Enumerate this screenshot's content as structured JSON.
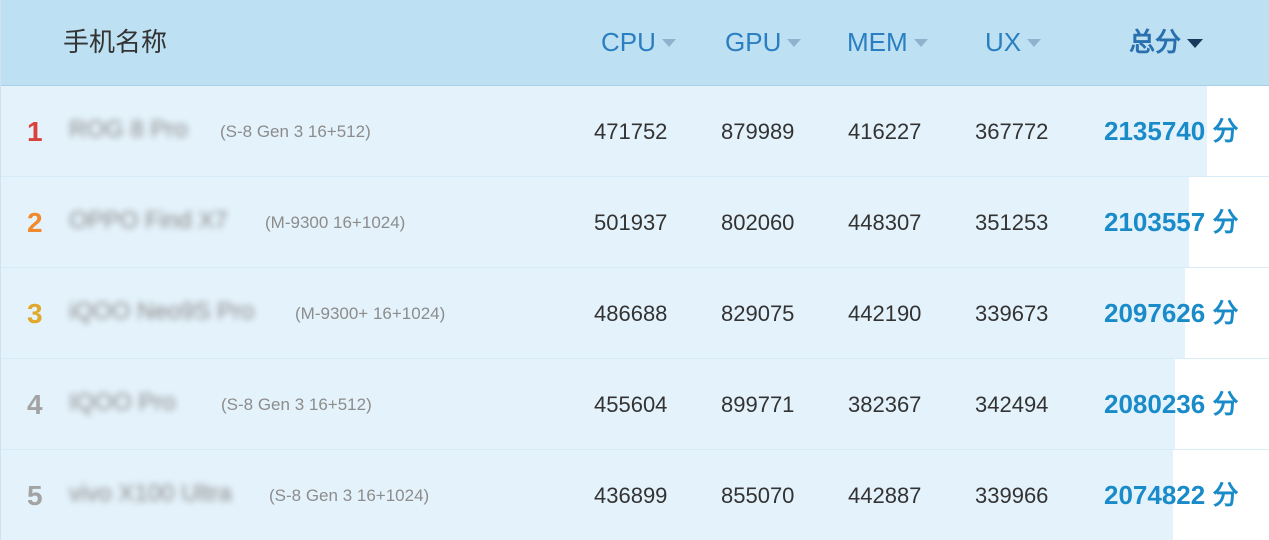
{
  "header": {
    "name_label": "手机名称",
    "cpu_label": "CPU",
    "gpu_label": "GPU",
    "mem_label": "MEM",
    "ux_label": "UX",
    "total_label": "总分"
  },
  "unit": "分",
  "colors": {
    "header_bg": "#bde0f3",
    "row_bar": "#e4f2fb",
    "total_text": "#1a8bc9",
    "rank_1": "#d9423c",
    "rank_2": "#f08a2c",
    "rank_3": "#e0a92a",
    "rank_other": "#a3a3a3"
  },
  "rows": [
    {
      "rank": "1",
      "name": "ROG 8 Pro",
      "chip": "(S-8 Gen 3 16+512)",
      "cpu": "471752",
      "gpu": "879989",
      "mem": "416227",
      "ux": "367772",
      "total": "2135740",
      "fill": 0.951
    },
    {
      "rank": "2",
      "name": "OPPO Find X7",
      "chip": "(M-9300 16+1024)",
      "cpu": "501937",
      "gpu": "802060",
      "mem": "448307",
      "ux": "351253",
      "total": "2103557",
      "fill": 0.937
    },
    {
      "rank": "3",
      "name": "iQOO Neo9S Pro",
      "chip": "(M-9300+ 16+1024)",
      "cpu": "486688",
      "gpu": "829075",
      "mem": "442190",
      "ux": "339673",
      "total": "2097626",
      "fill": 0.934
    },
    {
      "rank": "4",
      "name": "IQOO Pro",
      "chip": "(S-8 Gen 3 16+512)",
      "cpu": "455604",
      "gpu": "899771",
      "mem": "382367",
      "ux": "342494",
      "total": "2080236",
      "fill": 0.926
    },
    {
      "rank": "5",
      "name": "vivo X100 Ultra",
      "chip": "(S-8 Gen 3 16+1024)",
      "cpu": "436899",
      "gpu": "855070",
      "mem": "442887",
      "ux": "339966",
      "total": "2074822",
      "fill": 0.924
    }
  ]
}
